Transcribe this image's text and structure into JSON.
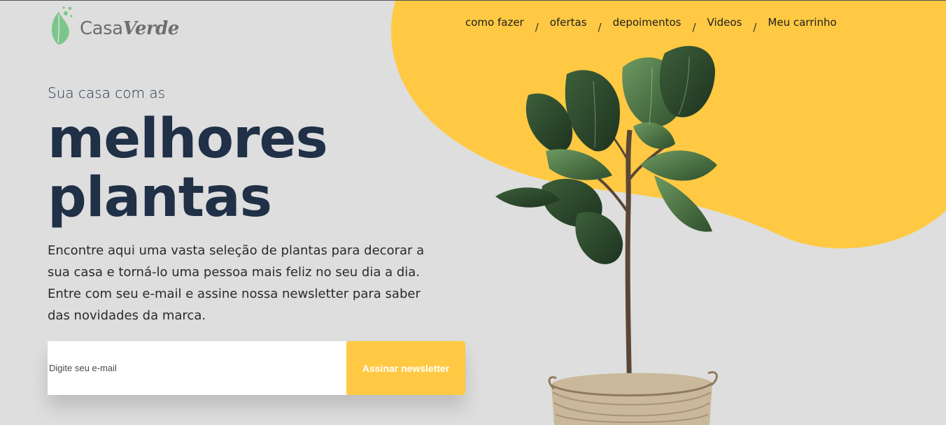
{
  "brand": {
    "name_part1": "Casa",
    "name_part2": "Verde"
  },
  "nav": {
    "items": [
      {
        "label": "como fazer"
      },
      {
        "label": "ofertas"
      },
      {
        "label": "depoimentos"
      },
      {
        "label": "Videos"
      },
      {
        "label": "Meu carrinho"
      }
    ],
    "separator": "/"
  },
  "hero": {
    "kicker": "Sua casa com as",
    "title_line1": "melhores",
    "title_line2": "plantas",
    "description": "Encontre aqui uma vasta seleção de plantas para decorar a sua casa e torná-lo uma pessoa mais feliz no seu dia a dia. Entre com seu e-mail e assine nossa newsletter para saber das novidades da marca."
  },
  "newsletter": {
    "placeholder": "Digite seu e-mail",
    "button_label": "Assinar newsletter"
  },
  "colors": {
    "accent": "#ffc943",
    "heading": "#1f3047",
    "background": "#dedede",
    "logo_green": "#7cc68a"
  }
}
